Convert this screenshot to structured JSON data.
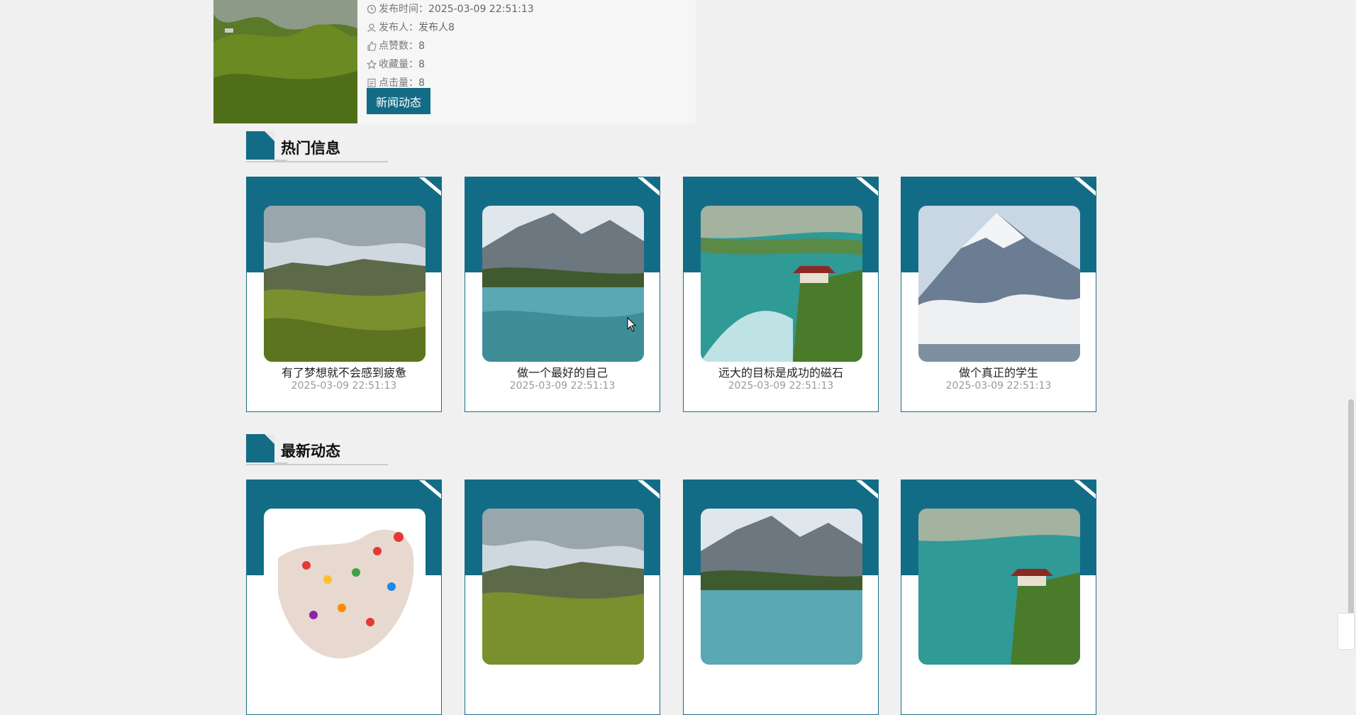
{
  "news": {
    "publish_time_label": "发布时间：",
    "publish_time": "2025-03-09 22:51:13",
    "publisher_label": "发布人：",
    "publisher": "发布人8",
    "likes_label": "点赞数：",
    "likes": "8",
    "favorites_label": "收藏量：",
    "favorites": "8",
    "clicks_label": "点击量：",
    "clicks": "8",
    "button_label": "新闻动态"
  },
  "hot": {
    "title": "热门信息",
    "items": [
      {
        "title": "有了梦想就不会感到疲惫",
        "date": "2025-03-09 22:51:13"
      },
      {
        "title": "做一个最好的自己",
        "date": "2025-03-09 22:51:13"
      },
      {
        "title": "远大的目标是成功的磁石",
        "date": "2025-03-09 22:51:13"
      },
      {
        "title": "做个真正的学生",
        "date": "2025-03-09 22:51:13"
      }
    ]
  },
  "latest": {
    "title": "最新动态"
  },
  "colors": {
    "accent": "#136c86",
    "background": "#f0f0f0"
  }
}
